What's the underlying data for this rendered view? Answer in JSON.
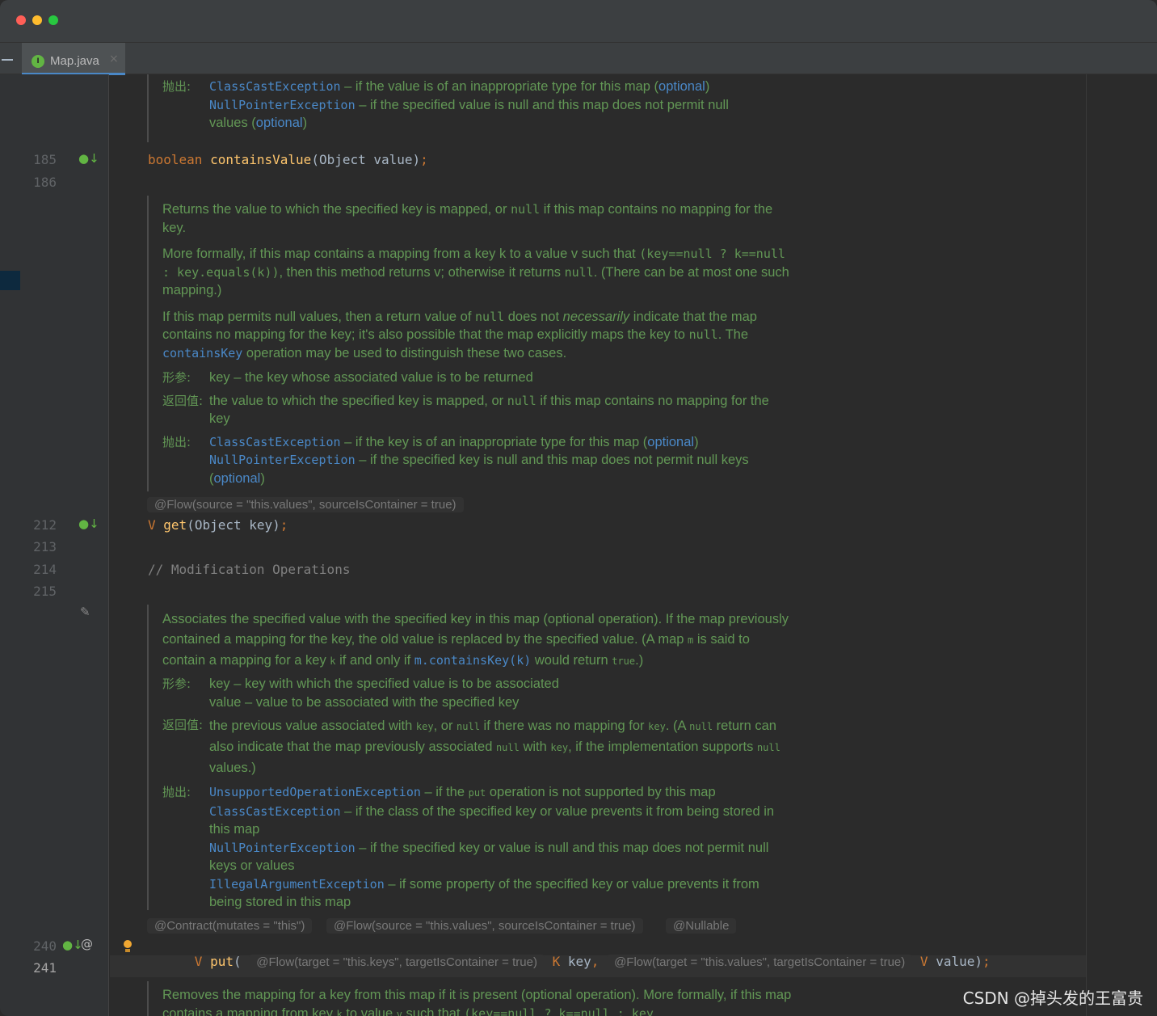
{
  "window": {
    "colors": {
      "close": "#ff5f57",
      "minimize": "#febc2e",
      "maximize": "#28c840"
    }
  },
  "tab": {
    "label": "Map.java",
    "close": "×",
    "icon_letter": "I",
    "icon": "interface-icon"
  },
  "gutter": {
    "lines": [
      "185",
      "186",
      "212",
      "213",
      "214",
      "215",
      "240",
      "241"
    ],
    "icons": {
      "implemented": "implemented-down-arrow-icon",
      "edit": "pencil-icon",
      "at": "@"
    }
  },
  "doc_top": {
    "throws_tag": "抛出:",
    "ex1": "ClassCastException",
    "ex1_text": " – if the value is of an inappropriate type for this map (",
    "optional": "optional",
    "close_paren": ")",
    "ex2": "NullPointerException",
    "ex2_text": " – if the specified value is null and this map does not permit null",
    "ex2_cont": "values ("
  },
  "code": {
    "contains_value": {
      "kw": "boolean",
      "name": "containsValue",
      "rest": "(Object value)",
      "semi": ";"
    },
    "get": {
      "type": "V",
      "name": "get",
      "rest": "(Object key)",
      "semi": ";"
    },
    "comment": "// Modification Operations",
    "put": {
      "type": "V",
      "name": "put",
      "open": "(",
      "type_k": "K",
      "key": "key",
      "comma": ",",
      "type_v": "V",
      "value": "value)",
      "semi": ";"
    }
  },
  "doc_get": {
    "p1_a": "Returns the value to which the specified key is mapped, or ",
    "null": "null",
    "p1_b": " if this map contains no mapping for the key.",
    "p2_a": "More formally, if this map contains a mapping from a key k to a value v such that ",
    "p2_code": "(key==null ? k==null : key.equals(k))",
    "p2_b": ", then this method returns v; otherwise it returns ",
    "p2_c": ". (There can be at most one such mapping.)",
    "p3_a": "If this map permits null values, then a return value of ",
    "p3_b": " does not ",
    "p3_em": "necessarily",
    "p3_c": " indicate that the map contains no mapping for the key; it's also possible that the map explicitly maps the key to ",
    "p3_d": ". The ",
    "p3_link": "containsKey",
    "p3_e": " operation may be used to distinguish these two cases.",
    "param_tag": "形参:",
    "param": "key – the key whose associated value is to be returned",
    "return_tag": "返回值:",
    "return_a": "the value to which the specified key is mapped, or ",
    "return_b": " if this map contains no mapping for the key",
    "throws_tag": "抛出:",
    "ex1": "ClassCastException",
    "ex1_text": " – if the key is of an inappropriate type for this map (",
    "optional": "optional",
    "close_paren": ")",
    "ex2": "NullPointerException",
    "ex2_text": " – if the specified key is null and this map does not permit null keys ("
  },
  "annotations": {
    "get_flow": "@Flow(source = \"this.values\", sourceIsContainer = true)",
    "put_contract": "@Contract(mutates = \"this\")",
    "put_flow": "@Flow(source = \"this.values\", sourceIsContainer = true)",
    "put_nullable": "@Nullable",
    "put_key_flow": "@Flow(target = \"this.keys\", targetIsContainer = true)",
    "put_value_flow": "@Flow(target = \"this.values\", targetIsContainer = true)"
  },
  "doc_put": {
    "p1_a": "Associates the specified value with the specified key in this map (optional operation). If the map previously contained a mapping for the key, the old value is replaced by the specified value. (A map ",
    "m": "m",
    "p1_b": " is said to contain a mapping for a key ",
    "k": "k",
    "p1_c": " if and only if ",
    "p1_link": "m.containsKey(k)",
    "p1_d": " would return ",
    "true": "true",
    "p1_e": ".)",
    "param_tag": "形参:",
    "param1": "key – key with which the specified value is to be associated",
    "param2": "value – value to be associated with the specified key",
    "return_tag": "返回值:",
    "r_a": "the previous value associated with ",
    "key": "key",
    "r_b": ", or ",
    "null": "null",
    "r_c": " if there was no mapping for ",
    "r_d": ". (A ",
    "r_e": " return can also indicate that the map previously associated ",
    "r_f": " with ",
    "r_g": ", if the implementation supports ",
    "r_h": " values.)",
    "throws_tag": "抛出:",
    "ex1": "UnsupportedOperationException",
    "ex1_a": " – if the ",
    "put": "put",
    "ex1_b": " operation is not supported by this map",
    "ex2": "ClassCastException",
    "ex2_text": " – if the class of the specified key or value prevents it from being stored in this map",
    "ex3": "NullPointerException",
    "ex3_text": " – if the specified key or value is null and this map does not permit null keys or values",
    "ex4": "IllegalArgumentException",
    "ex4_text": " – if some property of the specified key or value prevents it from being stored in this map"
  },
  "doc_remove": {
    "p1": "Removes the mapping for a key from this map if it is present (optional operation). More formally, if this map contains a mapping from key ",
    "k": "k",
    "p2": " to value ",
    "v": "v",
    "p3": " such that ",
    "code": "(key==null ? k==null : key"
  },
  "watermark": "CSDN @掉头发的王富贵"
}
